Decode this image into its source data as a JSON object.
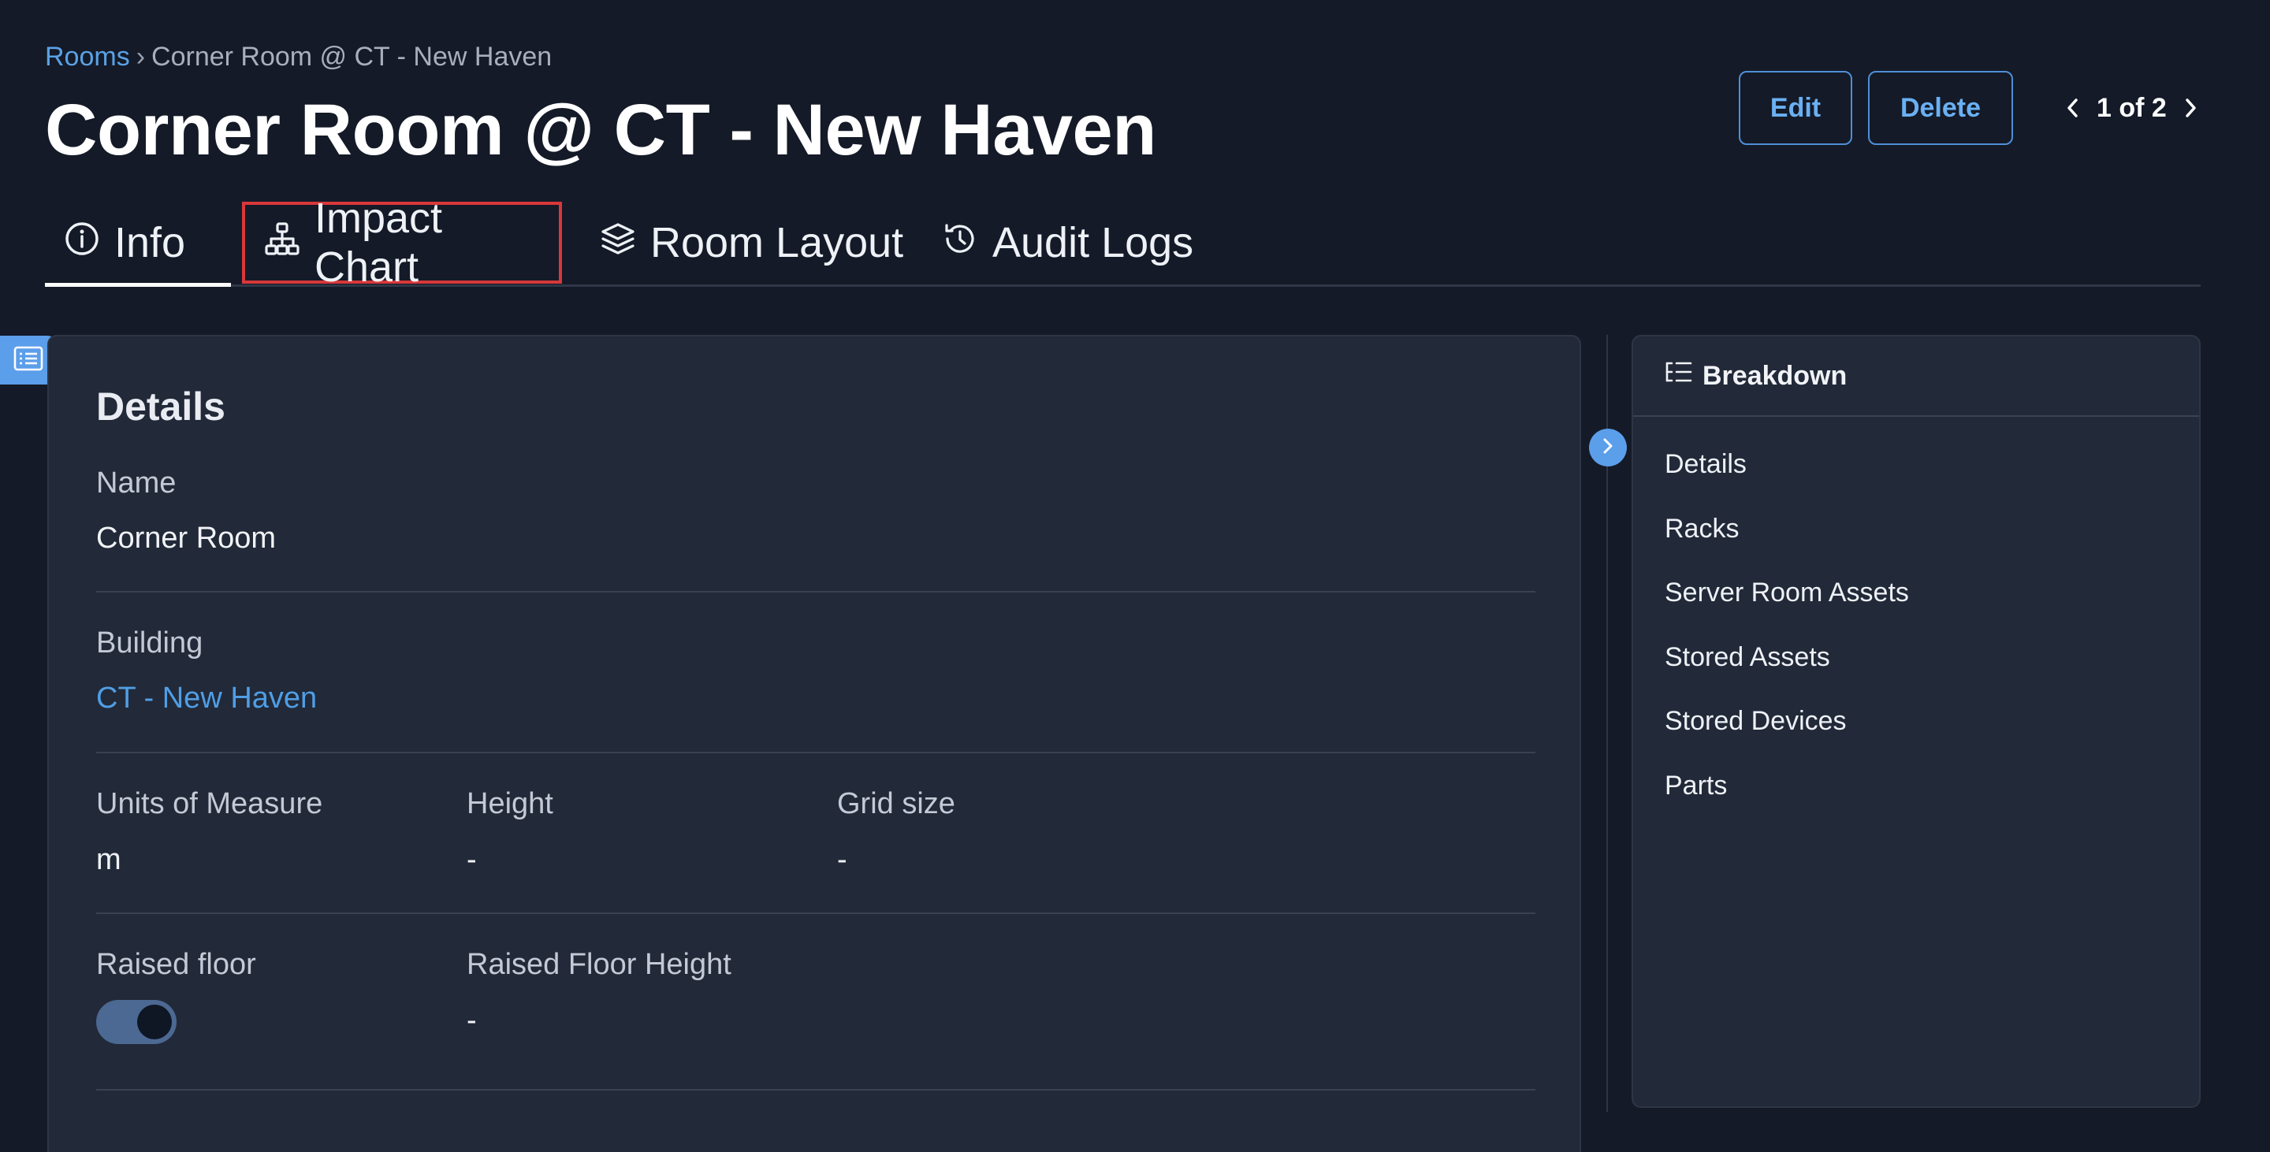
{
  "breadcrumb": {
    "root": "Rooms",
    "separator": "›",
    "current": "Corner Room @ CT - New Haven"
  },
  "title": "Corner Room @ CT - New Haven",
  "actions": {
    "edit_label": "Edit",
    "delete_label": "Delete",
    "pager_text": "1 of 2"
  },
  "tabs": [
    {
      "label": "Info",
      "icon": "info-circle-icon",
      "active": true
    },
    {
      "label": "Impact Chart",
      "icon": "hierarchy-icon",
      "highlighted": true
    },
    {
      "label": "Room Layout",
      "icon": "layers-icon"
    },
    {
      "label": "Audit Logs",
      "icon": "history-icon"
    }
  ],
  "details": {
    "title": "Details",
    "name_label": "Name",
    "name_value": "Corner Room",
    "building_label": "Building",
    "building_value": "CT - New Haven",
    "uom_label": "Units of Measure",
    "uom_value": "m",
    "height_label": "Height",
    "height_value": "-",
    "grid_label": "Grid size",
    "grid_value": "-",
    "raised_floor_label": "Raised floor",
    "raised_floor_on": true,
    "raised_floor_height_label": "Raised Floor Height",
    "raised_floor_height_value": "-"
  },
  "breakdown": {
    "title": "Breakdown",
    "items": [
      "Details",
      "Racks",
      "Server Room Assets",
      "Stored Assets",
      "Stored Devices",
      "Parts"
    ]
  },
  "colors": {
    "background": "#141a27",
    "card": "#222938",
    "accent": "#5b9eea",
    "link": "#4f9ee6",
    "highlight_border": "#d8383a"
  }
}
